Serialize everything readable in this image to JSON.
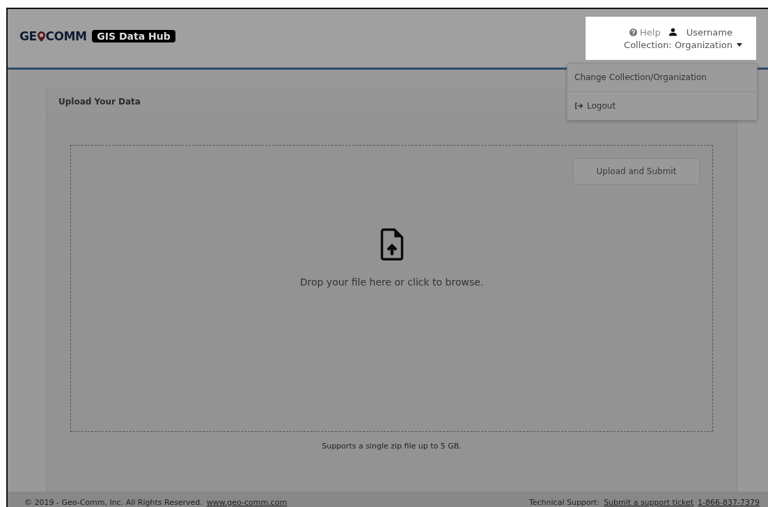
{
  "header": {
    "logo": {
      "brand_start": "GE",
      "brand_end": "COMM",
      "product": "GIS Data Hub"
    },
    "help": "Help",
    "username": "Username",
    "collection": "Collection: Organization"
  },
  "menu": {
    "expanded": true,
    "items": [
      {
        "label": "Change Collection/Organization",
        "kind": "text"
      },
      {
        "label": "Logout",
        "kind": "logout"
      }
    ]
  },
  "panel": {
    "title": "Upload Your Data",
    "button": "Upload and Submit",
    "drop_text": "Drop your file here or click to browse.",
    "note": "Supports a single zip file up to 5 GB."
  },
  "footer": {
    "copyright": "© 2019 - Geo-Comm, Inc. All Rights Reserved.",
    "website": "www.geo-comm.com",
    "support_label": "Technical Support:",
    "ticket_link": "Submit a support ticket",
    "phone": "1-866-837-7379"
  }
}
